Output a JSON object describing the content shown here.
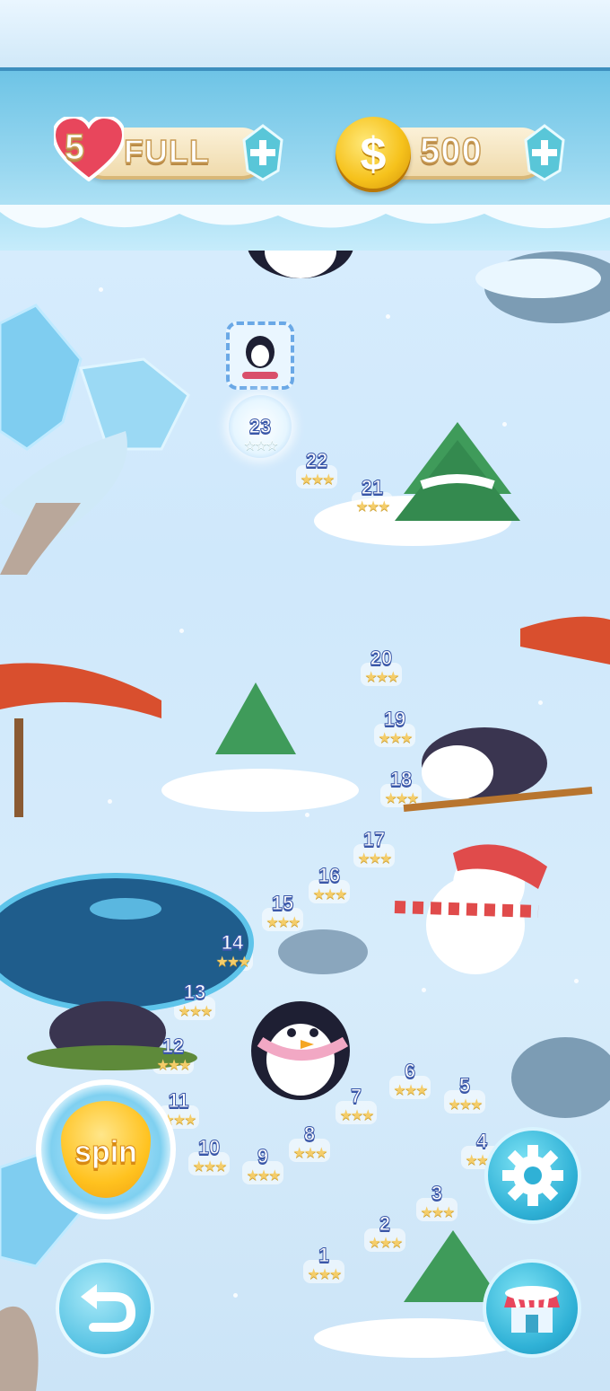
{
  "lives": {
    "count": "5",
    "status": "FULL"
  },
  "coins": {
    "amount": "500",
    "symbol": "$"
  },
  "colors": {
    "ice_dark": "#3d8fbe",
    "accent_gold": "#f6c21c",
    "pill": "#f5e4bd",
    "heart": "#e8465c"
  },
  "current_level": {
    "number": "23",
    "stars": "☆☆☆"
  },
  "levels": [
    {
      "number": "1",
      "stars": "★★★"
    },
    {
      "number": "2",
      "stars": "★★★"
    },
    {
      "number": "3",
      "stars": "★★★"
    },
    {
      "number": "4",
      "stars": "★★★"
    },
    {
      "number": "5",
      "stars": "★★★"
    },
    {
      "number": "6",
      "stars": "★★★"
    },
    {
      "number": "7",
      "stars": "★★★"
    },
    {
      "number": "8",
      "stars": "★★★"
    },
    {
      "number": "9",
      "stars": "★★★"
    },
    {
      "number": "10",
      "stars": "★★★"
    },
    {
      "number": "11",
      "stars": "★★★"
    },
    {
      "number": "12",
      "stars": "★★★"
    },
    {
      "number": "13",
      "stars": "★★★"
    },
    {
      "number": "14",
      "stars": "★★★"
    },
    {
      "number": "15",
      "stars": "★★★"
    },
    {
      "number": "16",
      "stars": "★★★"
    },
    {
      "number": "17",
      "stars": "★★★"
    },
    {
      "number": "18",
      "stars": "★★★"
    },
    {
      "number": "19",
      "stars": "★★★"
    },
    {
      "number": "20",
      "stars": "★★★"
    },
    {
      "number": "21",
      "stars": "★★★"
    },
    {
      "number": "22",
      "stars": "★★★"
    }
  ],
  "buttons": {
    "spin_label": "spin"
  },
  "icons": {
    "lives": "heart-icon",
    "coin": "coin-icon",
    "add": "plus-gem-icon",
    "settings": "gear-icon",
    "back": "undo-arrow-icon",
    "shop": "shop-icon",
    "avatar": "penguin-snowboard-icon"
  }
}
